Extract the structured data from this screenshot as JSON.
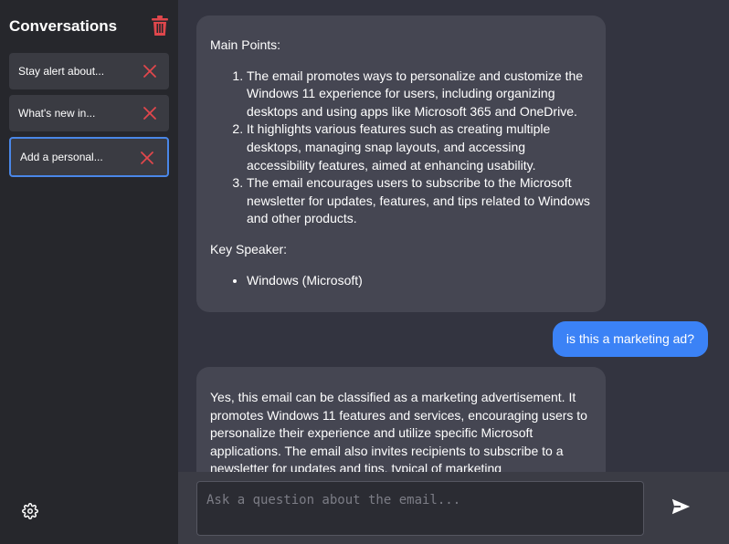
{
  "sidebar": {
    "title": "Conversations",
    "delete_all_icon": "trash-icon",
    "conversations": [
      {
        "label": "Stay alert about...",
        "active": false
      },
      {
        "label": "What's new in...",
        "active": false
      },
      {
        "label": "Add a personal...",
        "active": true
      }
    ],
    "settings_icon": "gear-icon"
  },
  "chat": {
    "messages": [
      {
        "role": "assistant",
        "main_points_heading": "Main Points:",
        "points": [
          "The email promotes ways to personalize and customize the Windows 11 experience for users, including organizing desktops and using apps like Microsoft 365 and OneDrive.",
          "It highlights various features such as creating multiple desktops, managing snap layouts, and accessing accessibility features, aimed at enhancing usability.",
          "The email encourages users to subscribe to the Microsoft newsletter for updates, features, and tips related to Windows and other products."
        ],
        "key_speaker_heading": "Key Speaker:",
        "speakers": [
          "Windows (Microsoft)"
        ]
      },
      {
        "role": "user",
        "text": "is this a marketing ad?"
      },
      {
        "role": "assistant",
        "text": "Yes, this email can be classified as a marketing advertisement. It promotes Windows 11 features and services, encouraging users to personalize their experience and utilize specific Microsoft applications. The email also invites recipients to subscribe to a newsletter for updates and tips, typical of marketing"
      }
    ]
  },
  "input": {
    "placeholder": "Ask a question about the email...",
    "value": "",
    "send_icon": "send-icon"
  },
  "colors": {
    "sidebar_bg": "#26272c",
    "main_bg": "#333440",
    "assistant_bubble": "#454652",
    "user_bubble": "#3b82f6",
    "danger": "#e0474c",
    "active_border": "#4a87e8"
  }
}
